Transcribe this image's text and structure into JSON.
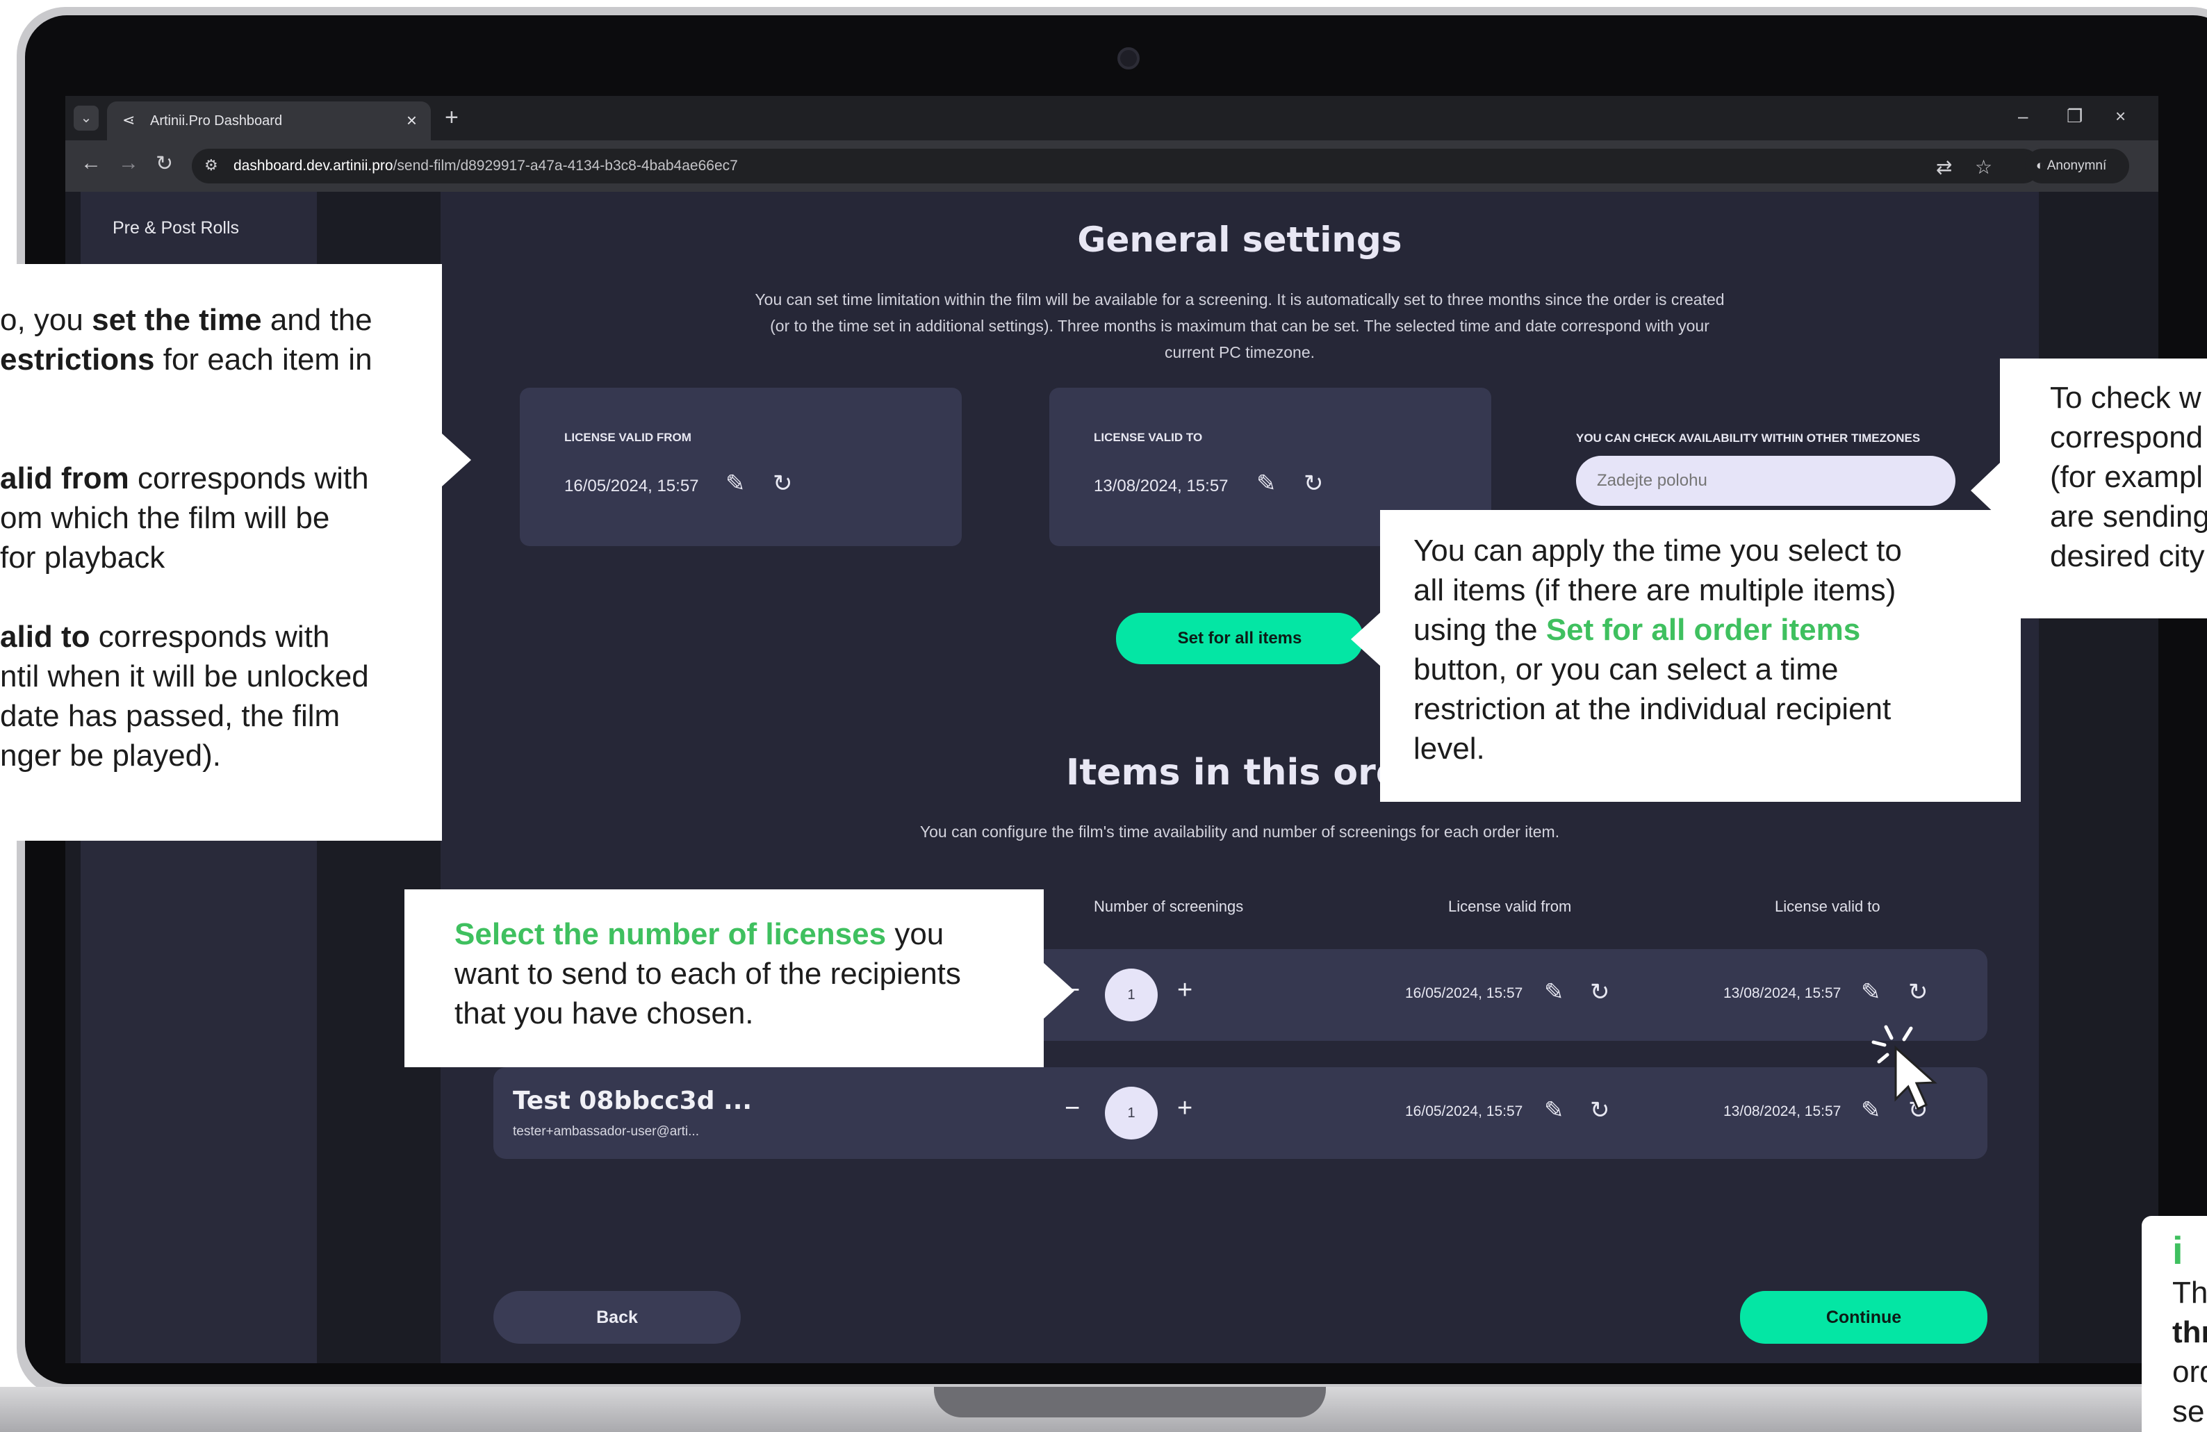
{
  "browser": {
    "tab_title": "Artinii.Pro Dashboard",
    "url_host": "dashboard.dev.artinii.pro",
    "url_path": "/send-film/d8929917-a47a-4134-b3c8-4bab4ae66ec7",
    "profile_label": "Anonymní"
  },
  "sidebar": {
    "item": "Pre & Post Rolls"
  },
  "general": {
    "title": "General settings",
    "description": [
      "You can set time limitation within the film will be available for a screening. It is automatically set to three months since the order is created",
      "(or to the time set in additional settings). Three months is maximum that can be set. The selected time and date correspond with your",
      "current PC timezone."
    ],
    "valid_from_label": "LICENSE VALID FROM",
    "valid_from_value": "16/05/2024, 15:57",
    "valid_to_label": "LICENSE VALID TO",
    "valid_to_value": "13/08/2024, 15:57",
    "timezone_label": "YOU CAN CHECK AVAILABILITY WITHIN OTHER TIMEZONES",
    "timezone_placeholder": "Zadejte polohu",
    "set_all_button": "Set for all items"
  },
  "items": {
    "title": "Items in this orde",
    "description": "You can configure the film's time availability and number of screenings for each order item.",
    "columns": [
      "Number of screenings",
      "License valid from",
      "License valid to"
    ],
    "rows": [
      {
        "name": "",
        "email": "",
        "screenings": "1",
        "from": "16/05/2024, 15:57",
        "to": "13/08/2024, 15:57"
      },
      {
        "name": "Test 08bbcc3d ...",
        "email": "tester+ambassador-user@arti...",
        "screenings": "1",
        "from": "16/05/2024, 15:57",
        "to": "13/08/2024, 15:57"
      }
    ]
  },
  "footer": {
    "back": "Back",
    "continue": "Continue"
  },
  "callouts": {
    "left": {
      "l1a": "o, you ",
      "l1b": "set the time",
      "l1c": " and the",
      "l2a": "estrictions",
      "l2b": " for each item in",
      "l3a": "alid from",
      "l3b": " corresponds with",
      "l4": "om which the film will be",
      "l5": "for playback",
      "l6a": "alid to",
      "l6b": " corresponds with",
      "l7": "ntil when it will be unlocked",
      "l8": "date has passed, the film",
      "l9": "nger be played)."
    },
    "right": {
      "l1": "To check w",
      "l2": "correspond",
      "l3": "(for exampl",
      "l4": "are sending",
      "l5": "desired city"
    },
    "middle": {
      "l1": "You can apply the time you select to",
      "l2": "all items (if there are multiple items)",
      "l3a": "using the ",
      "l3b": "Set for all order items",
      "l4": "button, or you can select a time",
      "l5": "restriction at the individual recipient",
      "l6": "level."
    },
    "licenses": {
      "l1a": "Select the number of licenses",
      "l1b": " you",
      "l2": "want to send to each of the recipients",
      "l3": "that you have chosen."
    },
    "info": {
      "icon": "i",
      "l1": "Th",
      "l2": "thr",
      "l3": "ord",
      "l4": "se"
    }
  },
  "colors": {
    "accent": "#04e6a4",
    "callout_highlight": "#3fc05f",
    "panel": "#262737",
    "card": "#363850"
  }
}
